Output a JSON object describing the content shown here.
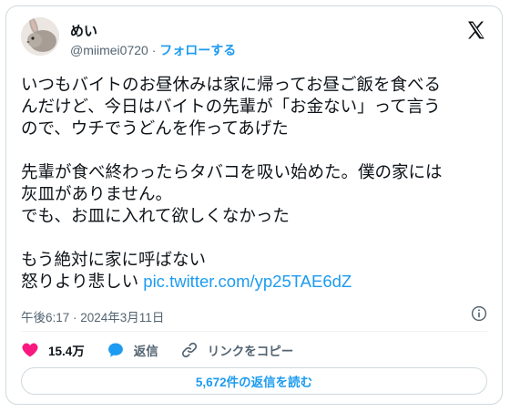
{
  "user": {
    "display_name": "めい",
    "handle": "@miimei0720",
    "separator": "·",
    "follow_label": "フォローする"
  },
  "tweet": {
    "lines": [
      "いつもバイトのお昼休みは家に帰ってお昼ご飯を食べる",
      "んだけど、今日はバイトの先輩が「お金ない」って言う",
      "ので、ウチでうどんを作ってあげた",
      "先輩が食べ終わったらタバコを吸い始めた。僕の家には",
      "灰皿がありません。",
      "でも、お皿に入れて欲しくなかった",
      "もう絶対に家に呼ばない",
      "怒りより悲しい"
    ],
    "link": "pic.twitter.com/yp25TAE6dZ",
    "timestamp": "午後6:17 · 2024年3月11日"
  },
  "actions": {
    "like_count": "15.4万",
    "reply_label": "返信",
    "copy_link_label": "リンクをコピー"
  },
  "read_replies_label": "5,672件の返信を読む",
  "icons": {
    "brand": "x-logo-icon",
    "like": "heart-icon",
    "reply": "speech-bubble-icon",
    "copy": "link-icon",
    "info": "info-icon"
  },
  "colors": {
    "link": "#1d9bf0",
    "like": "#f91880",
    "text": "#0f1419",
    "muted": "#536471"
  }
}
